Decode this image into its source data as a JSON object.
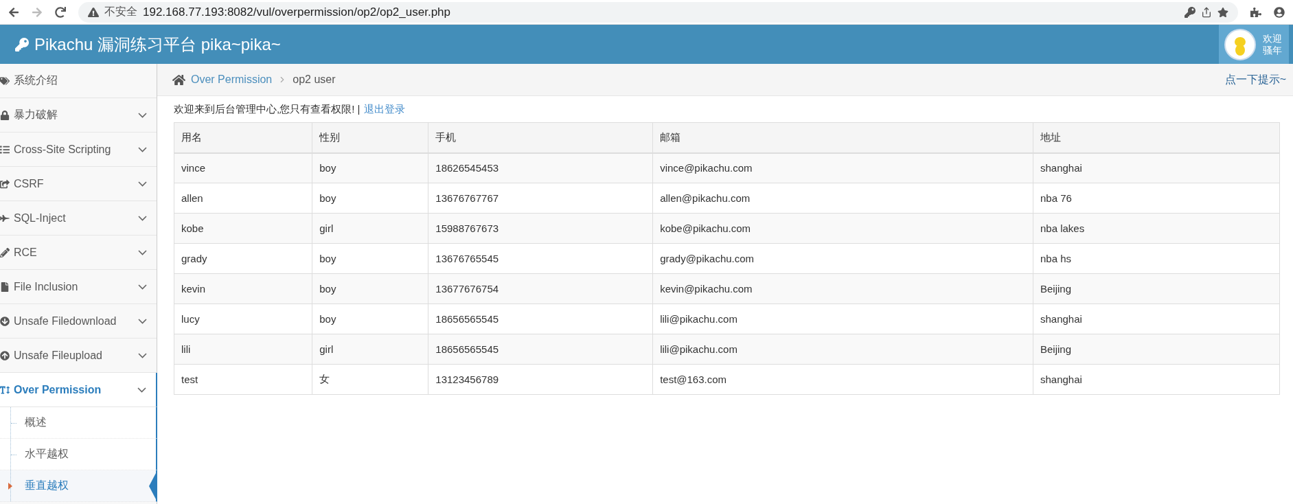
{
  "browser": {
    "security_label": "不安全",
    "url": "192.168.77.193:8082/vul/overpermission/op2/op2_user.php"
  },
  "header": {
    "title": "Pikachu 漏洞练习平台 pika~pika~",
    "greeting": [
      "欢迎",
      "骚年"
    ]
  },
  "sidebar": {
    "items": [
      {
        "label": "系统介绍",
        "expandable": false,
        "selected": false
      },
      {
        "label": "暴力破解",
        "expandable": true,
        "selected": false
      },
      {
        "label": "Cross-Site Scripting",
        "expandable": true,
        "selected": false
      },
      {
        "label": "CSRF",
        "expandable": true,
        "selected": false
      },
      {
        "label": "SQL-Inject",
        "expandable": true,
        "selected": false
      },
      {
        "label": "RCE",
        "expandable": true,
        "selected": false
      },
      {
        "label": "File Inclusion",
        "expandable": true,
        "selected": false
      },
      {
        "label": "Unsafe Filedownload",
        "expandable": true,
        "selected": false
      },
      {
        "label": "Unsafe Fileupload",
        "expandable": true,
        "selected": false
      },
      {
        "label": "Over Permission",
        "expandable": true,
        "expanded": true,
        "selected": true,
        "children": [
          {
            "label": "概述",
            "selected": false
          },
          {
            "label": "水平越权",
            "selected": false
          },
          {
            "label": "垂直越权",
            "selected": true
          }
        ]
      }
    ]
  },
  "breadcrumb": {
    "parent": "Over Permission",
    "current": "op2 user",
    "hint": "点一下提示~"
  },
  "welcome": {
    "text": "欢迎来到后台管理中心,您只有查看权限! |",
    "logout": "退出登录"
  },
  "table": {
    "columns": [
      "用名",
      "性别",
      "手机",
      "邮箱",
      "地址"
    ],
    "rows": [
      [
        "vince",
        "boy",
        "18626545453",
        "vince@pikachu.com",
        "shanghai"
      ],
      [
        "allen",
        "boy",
        "13676767767",
        "allen@pikachu.com",
        "nba 76"
      ],
      [
        "kobe",
        "girl",
        "15988767673",
        "kobe@pikachu.com",
        "nba lakes"
      ],
      [
        "grady",
        "boy",
        "13676765545",
        "grady@pikachu.com",
        "nba hs"
      ],
      [
        "kevin",
        "boy",
        "13677676754",
        "kevin@pikachu.com",
        "Beijing"
      ],
      [
        "lucy",
        "boy",
        "18656565545",
        "lili@pikachu.com",
        "shanghai"
      ],
      [
        "lili",
        "girl",
        "18656565545",
        "lili@pikachu.com",
        "Beijing"
      ],
      [
        "test",
        "女",
        "13123456789",
        "test@163.com",
        "shanghai"
      ]
    ]
  }
}
